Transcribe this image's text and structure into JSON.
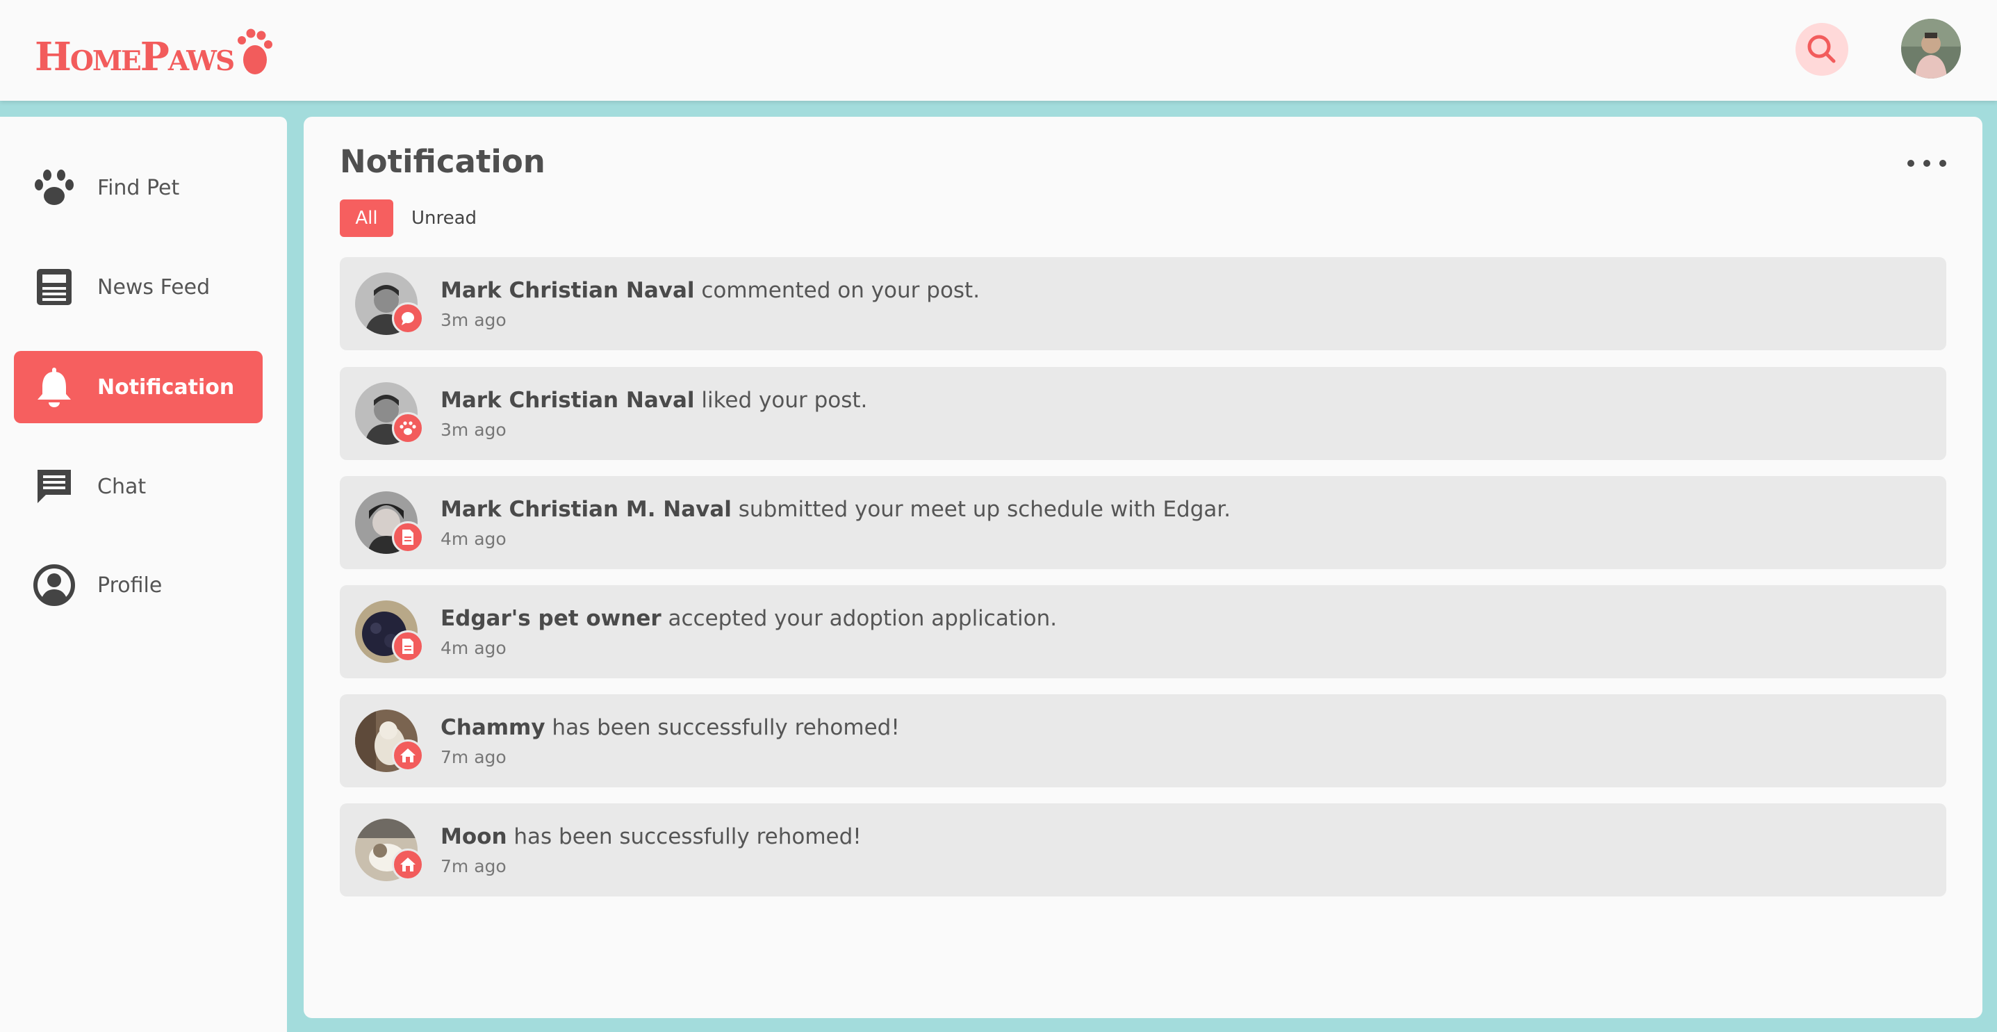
{
  "brand": {
    "name": "HomePaws",
    "accent": "#f65f5f",
    "background": "#a3dcdc"
  },
  "header": {
    "search_icon": "search-icon",
    "avatar": "user-avatar"
  },
  "sidebar": {
    "items": [
      {
        "label": "Find Pet",
        "icon": "paw-icon",
        "active": false
      },
      {
        "label": "News Feed",
        "icon": "newspaper-icon",
        "active": false
      },
      {
        "label": "Notification",
        "icon": "bell-icon",
        "active": true
      },
      {
        "label": "Chat",
        "icon": "chat-icon",
        "active": false
      },
      {
        "label": "Profile",
        "icon": "profile-icon",
        "active": false
      }
    ]
  },
  "main": {
    "title": "Notification",
    "filters": {
      "all": "All",
      "unread": "Unread",
      "selected": "All"
    },
    "notifications": [
      {
        "actor": "Mark Christian Naval",
        "message": " commented on your post.",
        "time": "3m ago",
        "badge_icon": "comment-icon"
      },
      {
        "actor": "Mark Christian Naval",
        "message": " liked your post.",
        "time": "3m ago",
        "badge_icon": "paw-icon"
      },
      {
        "actor": "Mark Christian M. Naval",
        "message": " submitted your meet up schedule with Edgar.",
        "time": "4m ago",
        "badge_icon": "document-icon"
      },
      {
        "actor": "Edgar's pet owner",
        "message": " accepted your adoption application.",
        "time": "4m ago",
        "badge_icon": "document-icon"
      },
      {
        "actor": "Chammy",
        "message": " has been successfully rehomed!",
        "time": "7m ago",
        "badge_icon": "home-icon"
      },
      {
        "actor": "Moon",
        "message": " has been successfully rehomed!",
        "time": "7m ago",
        "badge_icon": "home-icon"
      }
    ]
  }
}
